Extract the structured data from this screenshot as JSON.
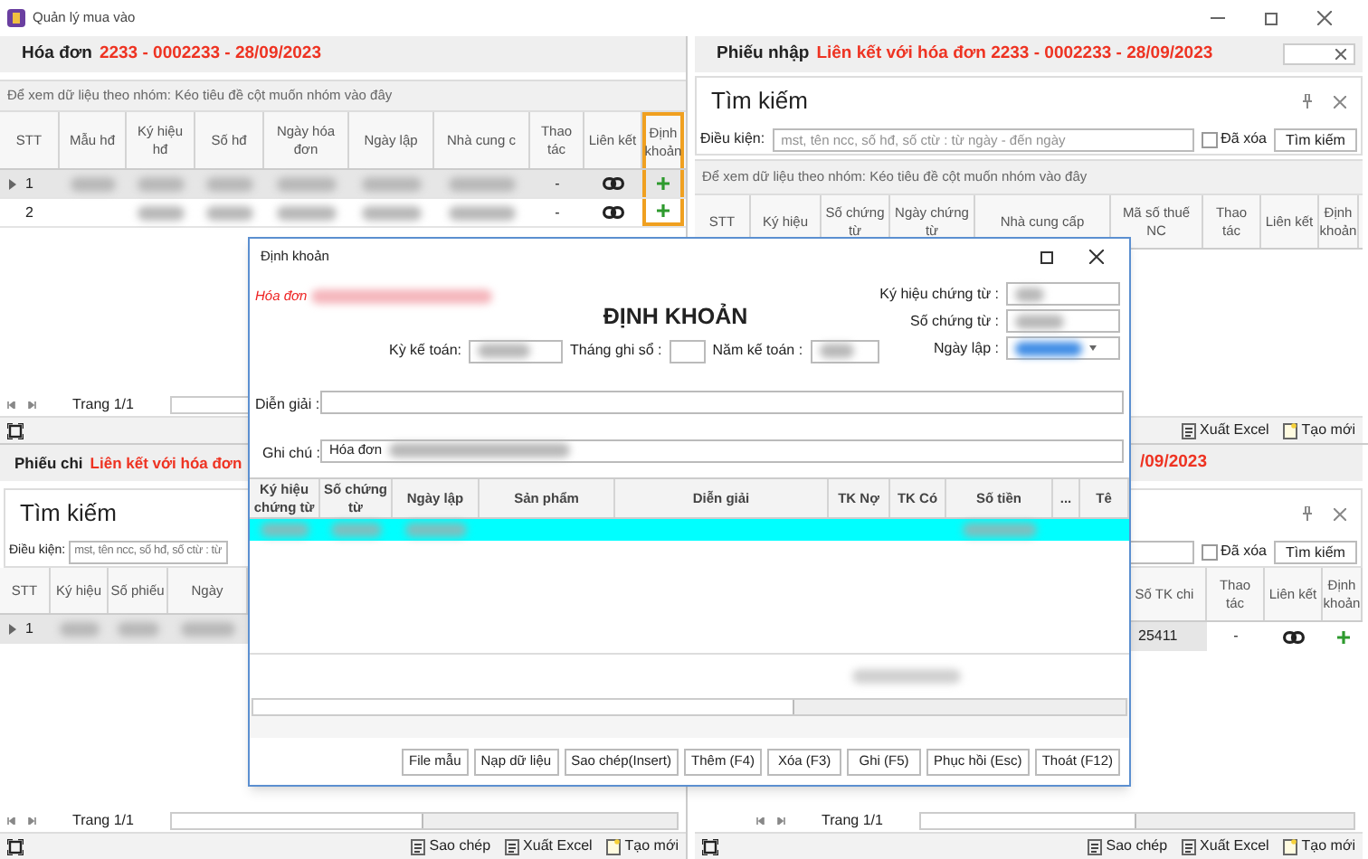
{
  "window": {
    "title": "Quản lý mua vào"
  },
  "invoice_panel": {
    "label": "Hóa đơn",
    "value": "2233 - 0002233 - 28/09/2023",
    "group_hint": "Để xem dữ liệu theo nhóm: Kéo tiêu đề cột muốn nhóm vào đây",
    "columns": [
      {
        "label": "STT",
        "highlighted": false
      },
      {
        "label": "Mẫu hđ",
        "highlighted": false
      },
      {
        "label": "Ký hiệu hđ",
        "highlighted": false
      },
      {
        "label": "Số hđ",
        "highlighted": false
      },
      {
        "label": "Ngày hóa đơn",
        "highlighted": false
      },
      {
        "label": "Ngày lập",
        "highlighted": false
      },
      {
        "label": "Nhà cung c",
        "highlighted": false
      },
      {
        "label": "Thao tác",
        "highlighted": false
      },
      {
        "label": "Liên kết",
        "highlighted": false
      },
      {
        "label": "Định khoản",
        "highlighted": true
      }
    ],
    "rows": [
      {
        "stt": "1",
        "selected": true,
        "cells": [
          {
            "kind": "blurred"
          },
          {
            "kind": "blurred"
          },
          {
            "kind": "blurred"
          },
          {
            "kind": "blurred"
          },
          {
            "kind": "blurred"
          },
          {
            "kind": "blurred"
          },
          {
            "kind": "text",
            "text": "-"
          },
          {
            "kind": "link"
          },
          {
            "kind": "add"
          }
        ]
      },
      {
        "stt": "2",
        "selected": false,
        "cells": [
          {
            "kind": "empty"
          },
          {
            "kind": "blurred"
          },
          {
            "kind": "blurred"
          },
          {
            "kind": "blurred"
          },
          {
            "kind": "blurred"
          },
          {
            "kind": "blurred"
          },
          {
            "kind": "text",
            "text": "-"
          },
          {
            "kind": "link"
          },
          {
            "kind": "add"
          }
        ]
      }
    ],
    "pager": "Trang 1/1"
  },
  "receipt_panel": {
    "label": "Phiếu nhập",
    "value": "Liên kết với hóa đơn 2233 - 0002233 - 28/09/2023",
    "search_title": "Tìm kiếm",
    "condition_label": "Điều kiện:",
    "placeholder": "mst, tên ncc, số hđ, số ctừ : từ ngày - đến ngày",
    "deleted_label": "Đã xóa",
    "deleted_checked": false,
    "search_button": "Tìm kiếm",
    "group_hint": "Để xem dữ liệu theo nhóm: Kéo tiêu đề cột muốn nhóm vào đây",
    "columns": [
      {
        "label": "STT"
      },
      {
        "label": "Ký hiệu"
      },
      {
        "label": "Số chứng từ"
      },
      {
        "label": "Ngày chứng từ"
      },
      {
        "label": "Nhà cung cấp"
      },
      {
        "label": "Mã số thuế NC"
      },
      {
        "label": "Thao tác"
      },
      {
        "label": "Liên kết"
      },
      {
        "label": "Định khoản"
      }
    ],
    "toolbar": [
      "Xuất Excel",
      "Tạo mới"
    ]
  },
  "payment_panel": {
    "label": "Phiếu chi",
    "value": "Liên kết với hóa đơn",
    "search_title": "Tìm kiếm",
    "condition_label": "Điều kiện:",
    "placeholder": "mst, tên ncc, số hđ, số ctừ : từ",
    "columns": [
      {
        "label": "STT"
      },
      {
        "label": "Ký hiệu"
      },
      {
        "label": "Số phiếu"
      },
      {
        "label": "Ngày"
      }
    ],
    "rows": [
      {
        "stt": "1",
        "selected": true,
        "cells": [
          {
            "kind": "blurred"
          },
          {
            "kind": "blurred"
          },
          {
            "kind": "blurred"
          }
        ]
      }
    ],
    "pager": "Trang 1/1",
    "toolbar": [
      "Sao chép",
      "Xuất Excel",
      "Tạo mới"
    ]
  },
  "right_payment_panel": {
    "value": "/09/2023",
    "deleted_label": "Đã xóa",
    "deleted_checked": false,
    "search_button": "Tìm kiếm",
    "columns": [
      {
        "label": "Số TK chi"
      },
      {
        "label": "Thao tác"
      },
      {
        "label": "Liên kết"
      },
      {
        "label": "Định khoản"
      }
    ],
    "rows": [
      {
        "selected": true,
        "cells": [
          {
            "kind": "text",
            "text": "25411"
          },
          {
            "kind": "text",
            "text": "-"
          },
          {
            "kind": "link"
          },
          {
            "kind": "add"
          }
        ]
      }
    ],
    "pager": "Trang 1/1",
    "toolbar": [
      "Sao chép",
      "Xuất Excel",
      "Tạo mới"
    ]
  },
  "dialog": {
    "title": "Định khoản",
    "source_label": "Hóa đơn",
    "heading": "ĐỊNH KHOẢN",
    "fields": {
      "period": "Kỳ kế toán:",
      "month": "Tháng ghi sổ :",
      "year": "Năm kế toán :",
      "symbol": "Ký hiệu chứng từ :",
      "number": "Số chứng từ :",
      "date": "Ngày lập :",
      "description": "Diễn giải :",
      "note": "Ghi chú :",
      "note_value": "Hóa đơn"
    },
    "columns": [
      {
        "label": "Ký hiệu chứng từ"
      },
      {
        "label": "Số chứng từ"
      },
      {
        "label": "Ngày lập"
      },
      {
        "label": "Sản phẩm"
      },
      {
        "label": "Diễn giải"
      },
      {
        "label": "TK Nợ"
      },
      {
        "label": "TK Có"
      },
      {
        "label": "Số tiền"
      },
      {
        "label": "..."
      },
      {
        "label": "Tê"
      }
    ],
    "rows": [
      {
        "selected": true,
        "cells": [
          {
            "kind": "blurred"
          },
          {
            "kind": "blurred"
          },
          {
            "kind": "blurred"
          },
          {
            "kind": "empty"
          },
          {
            "kind": "empty"
          },
          {
            "kind": "empty"
          },
          {
            "kind": "empty"
          },
          {
            "kind": "blurred"
          },
          {
            "kind": "empty"
          },
          {
            "kind": "empty"
          }
        ]
      }
    ],
    "buttons": [
      "File mẫu",
      "Nạp dữ liệu",
      "Sao chép(Insert)",
      "Thêm (F4)",
      "Xóa (F3)",
      "Ghi (F5)",
      "Phục hồi (Esc)",
      "Thoát (F12)"
    ]
  }
}
